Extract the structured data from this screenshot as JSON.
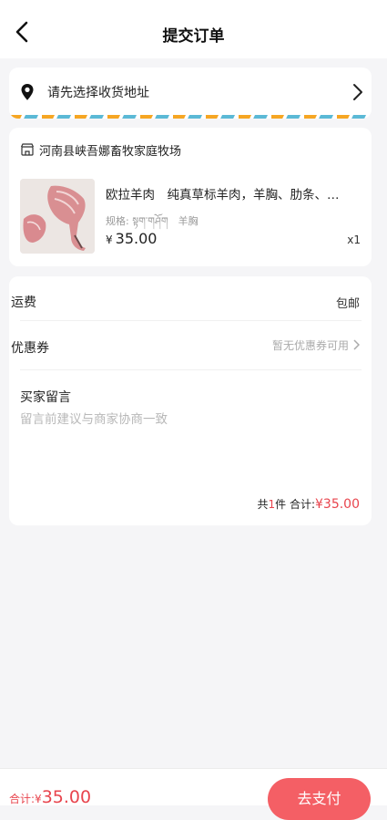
{
  "header": {
    "title": "提交订单"
  },
  "address": {
    "placeholder": "请先选择收货地址"
  },
  "shop": {
    "name": "河南县峡吾娜畜牧家庭牧场"
  },
  "product": {
    "title": "欧拉羊肉　纯真草标羊肉，羊胸、肋条、…",
    "spec": "规格: སྟག་གཤོག　羊胸",
    "currency": "¥",
    "price": "35.00",
    "qty": "x1"
  },
  "shipping": {
    "label": "运费",
    "value": "包邮"
  },
  "coupon": {
    "label": "优惠券",
    "value": "暂无优惠券可用"
  },
  "remark": {
    "label": "买家留言",
    "placeholder": "留言前建议与商家协商一致"
  },
  "summary": {
    "prefix": "共",
    "count": "1",
    "unit": "件 合计:",
    "total": "¥35.00"
  },
  "bottom": {
    "total_label": "合计:",
    "currency": "¥",
    "amount": "35.00",
    "pay_label": "去支付"
  },
  "colors": {
    "accent": "#f45f65",
    "price_red": "#e8444d",
    "stripe_orange": "#f6a623",
    "stripe_blue": "#5bb9d6"
  }
}
